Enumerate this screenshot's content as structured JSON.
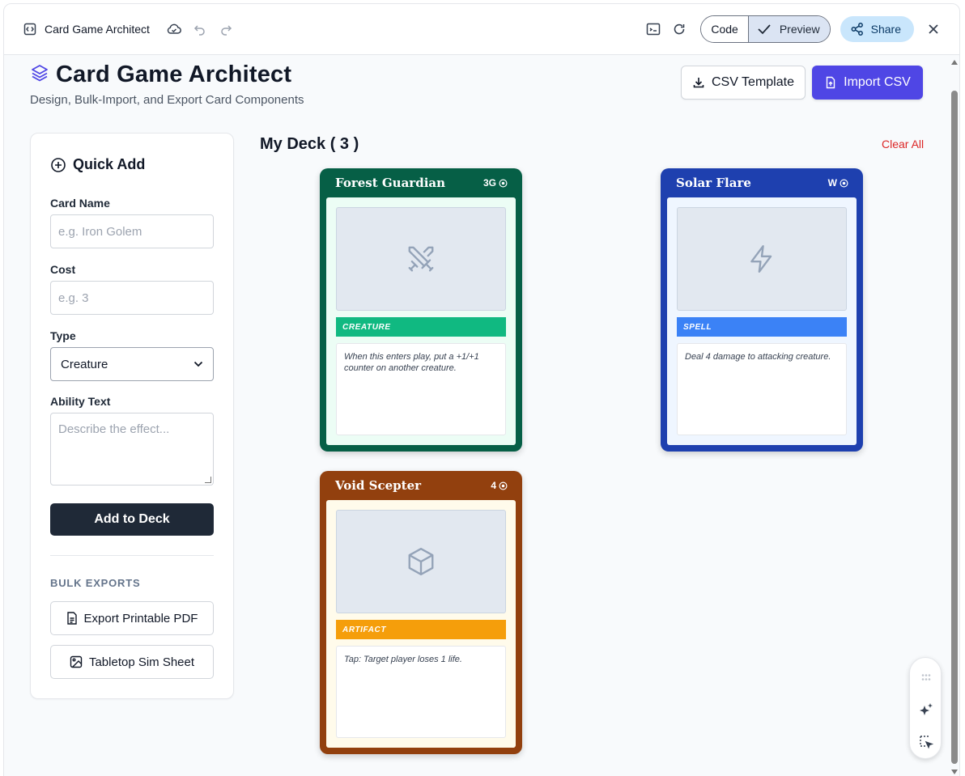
{
  "topbar": {
    "title": "Card Game Architect",
    "code_label": "Code",
    "preview_label": "Preview",
    "share_label": "Share"
  },
  "header": {
    "title": "Card Game Architect",
    "subtitle": "Design, Bulk-Import, and Export Card Components",
    "csv_template_label": "CSV Template",
    "import_csv_label": "Import CSV",
    "accent_color": "#4f46e5"
  },
  "sidebar": {
    "heading": "Quick Add",
    "card_name_label": "Card Name",
    "card_name_placeholder": "e.g. Iron Golem",
    "cost_label": "Cost",
    "cost_placeholder": "e.g. 3",
    "type_label": "Type",
    "type_value": "Creature",
    "ability_label": "Ability Text",
    "ability_placeholder": "Describe the effect...",
    "add_button": "Add to Deck",
    "bulk_heading": "BULK EXPORTS",
    "export_pdf": "Export Printable PDF",
    "tabletop_sheet": "Tabletop Sim Sheet"
  },
  "deck": {
    "title": "My Deck ( 3 )",
    "clear_all": "Clear All",
    "cards": [
      {
        "name": "Forest Guardian",
        "cost": "3G",
        "type": "CREATURE",
        "text": "When this enters play, put a +1/+1 counter on another creature.",
        "art_icon": "swords-icon",
        "frame_color": "#065f46",
        "inner_color": "#ecfdf5",
        "type_color": "#10b981"
      },
      {
        "name": "Solar Flare",
        "cost": "W",
        "type": "SPELL",
        "text": "Deal 4 damage to attacking creature.",
        "art_icon": "lightning-icon",
        "frame_color": "#1e40af",
        "inner_color": "#eff6ff",
        "type_color": "#3b82f6"
      },
      {
        "name": "Void Scepter",
        "cost": "4",
        "type": "ARTIFACT",
        "text": "Tap: Target player loses 1 life.",
        "art_icon": "cube-icon",
        "frame_color": "#92400e",
        "inner_color": "#fffbeb",
        "type_color": "#f59e0b"
      }
    ]
  }
}
